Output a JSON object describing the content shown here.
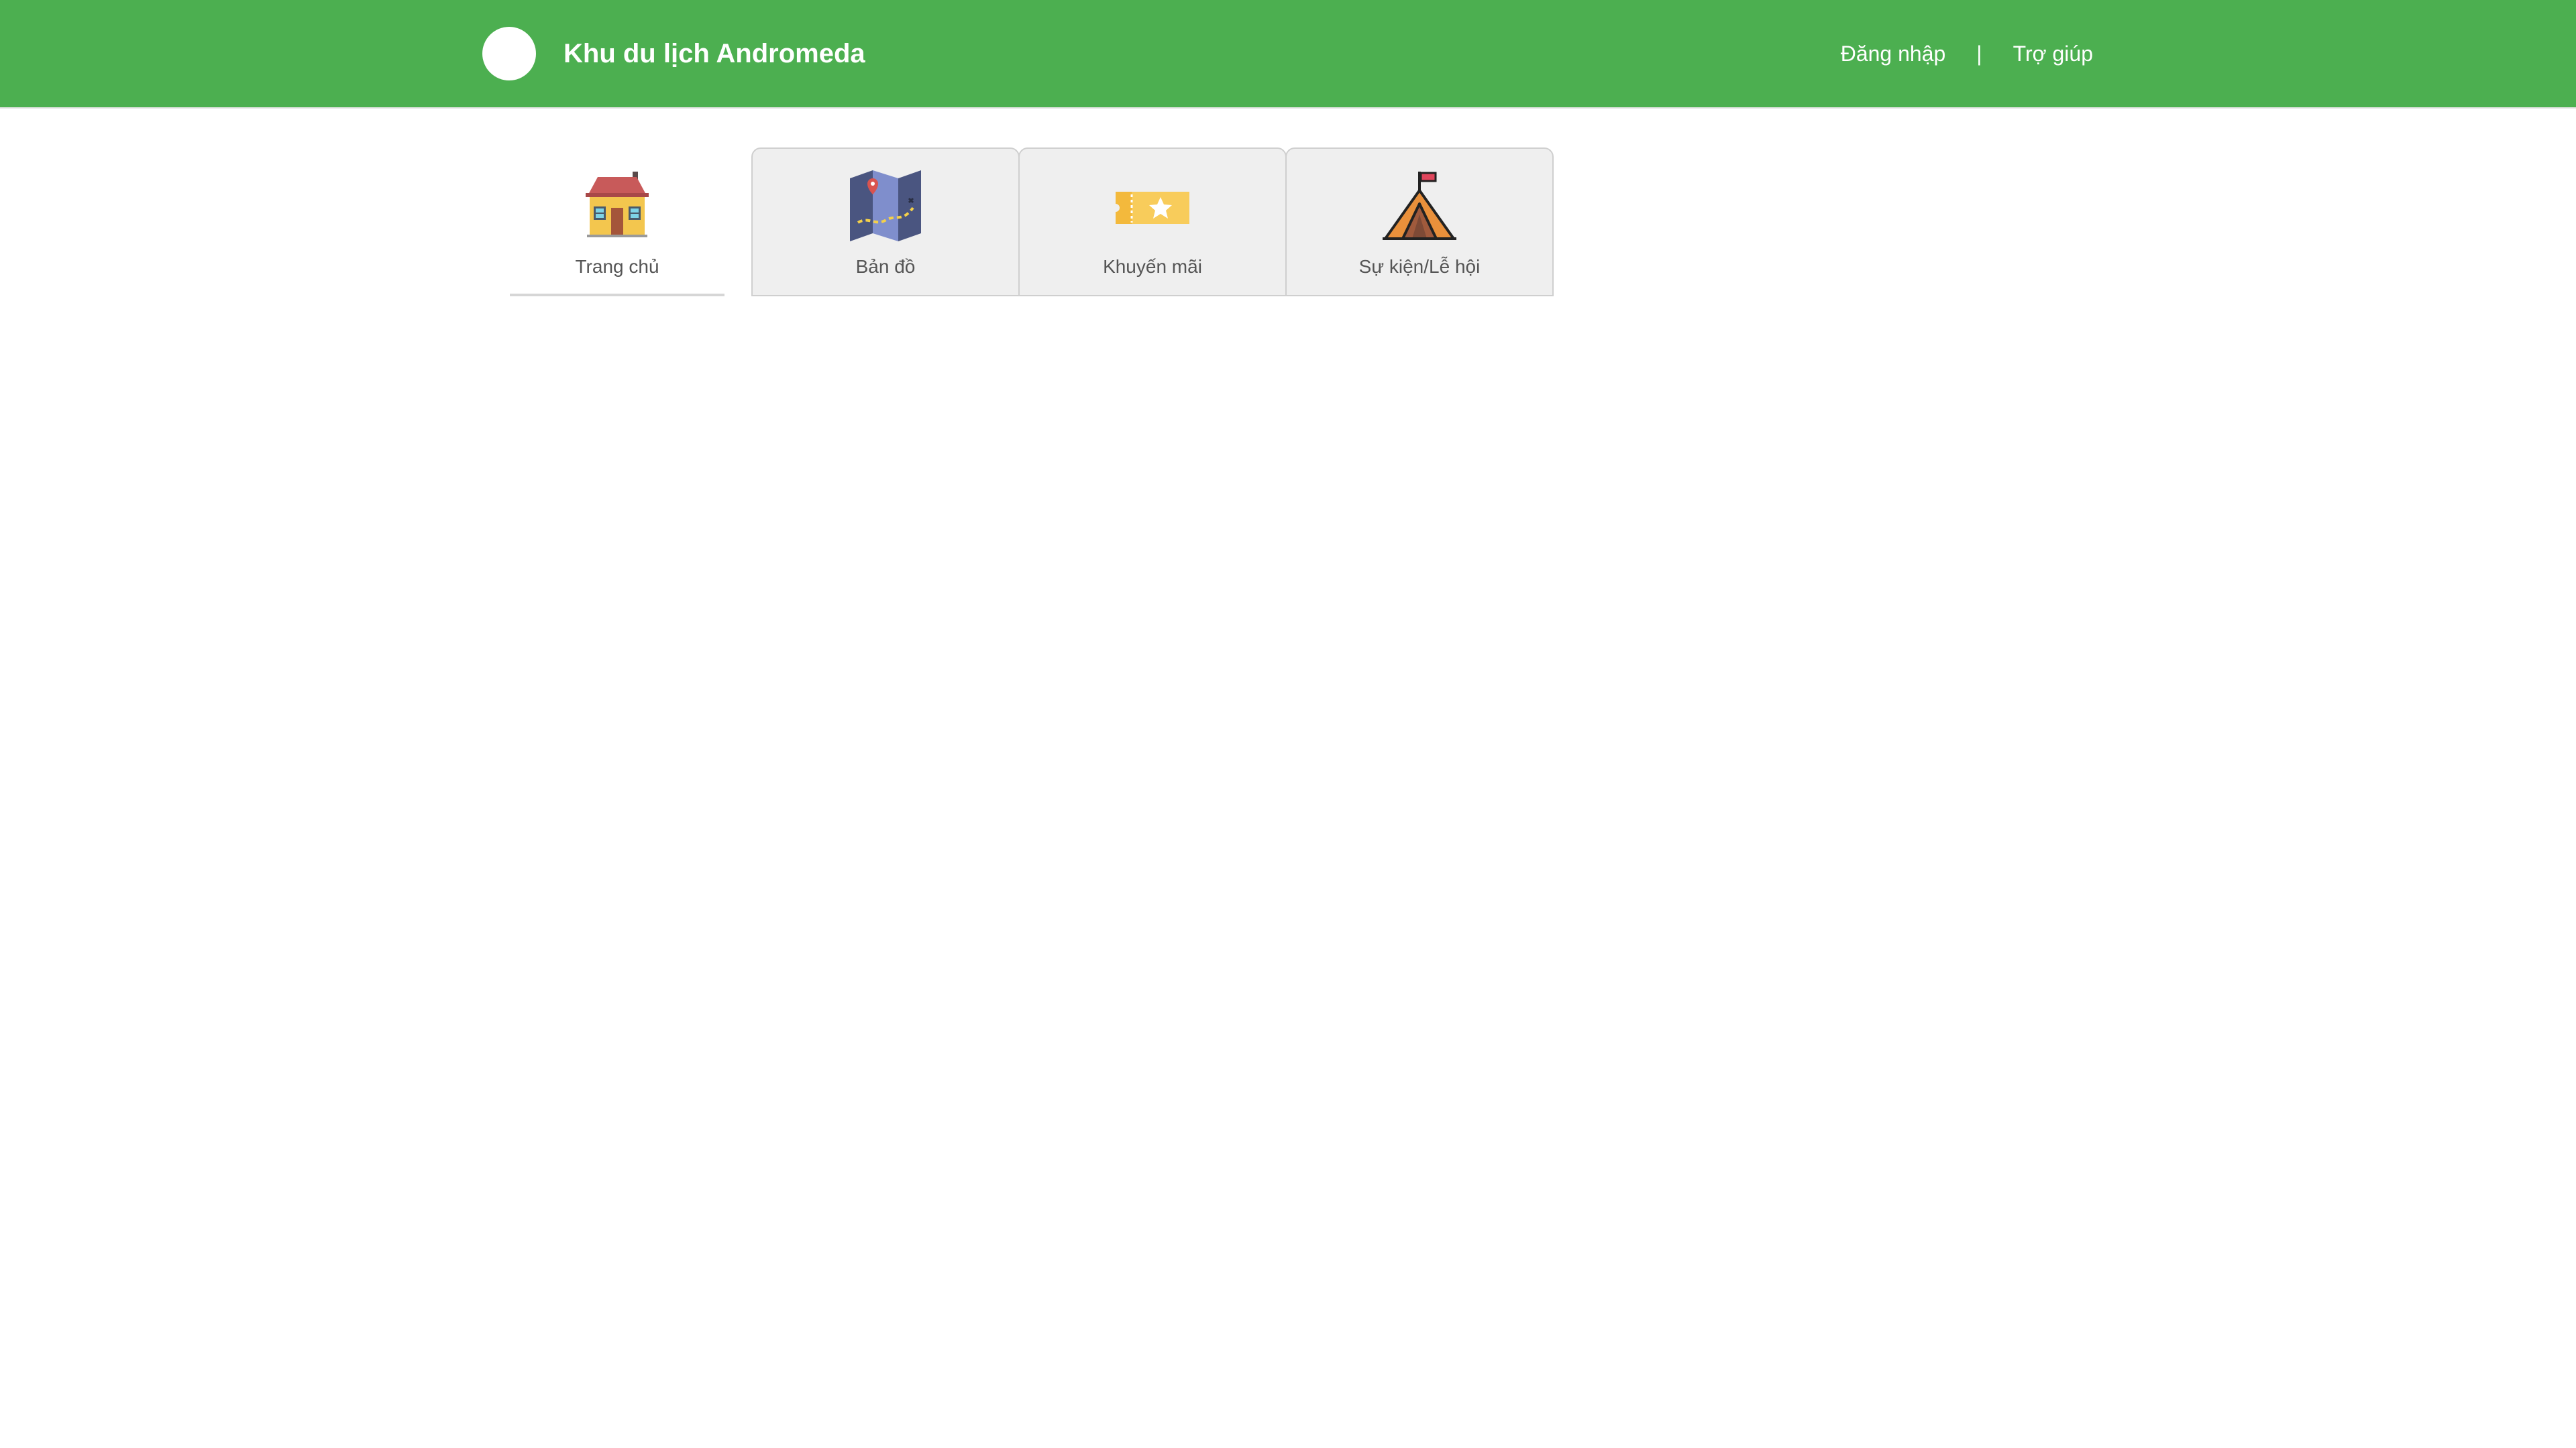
{
  "header": {
    "title": "Khu du lịch Andromeda",
    "login_label": "Đăng nhập",
    "separator": "|",
    "help_label": "Trợ giúp",
    "background_color": "#4caf50"
  },
  "tabs": [
    {
      "label": "Trang chủ",
      "icon": "house-icon",
      "active": true
    },
    {
      "label": "Bản đồ",
      "icon": "map-icon",
      "active": false
    },
    {
      "label": "Khuyến mãi",
      "icon": "ticket-star-icon",
      "active": false
    },
    {
      "label": "Sự kiện/Lễ hội",
      "icon": "tent-flag-icon",
      "active": false
    }
  ]
}
